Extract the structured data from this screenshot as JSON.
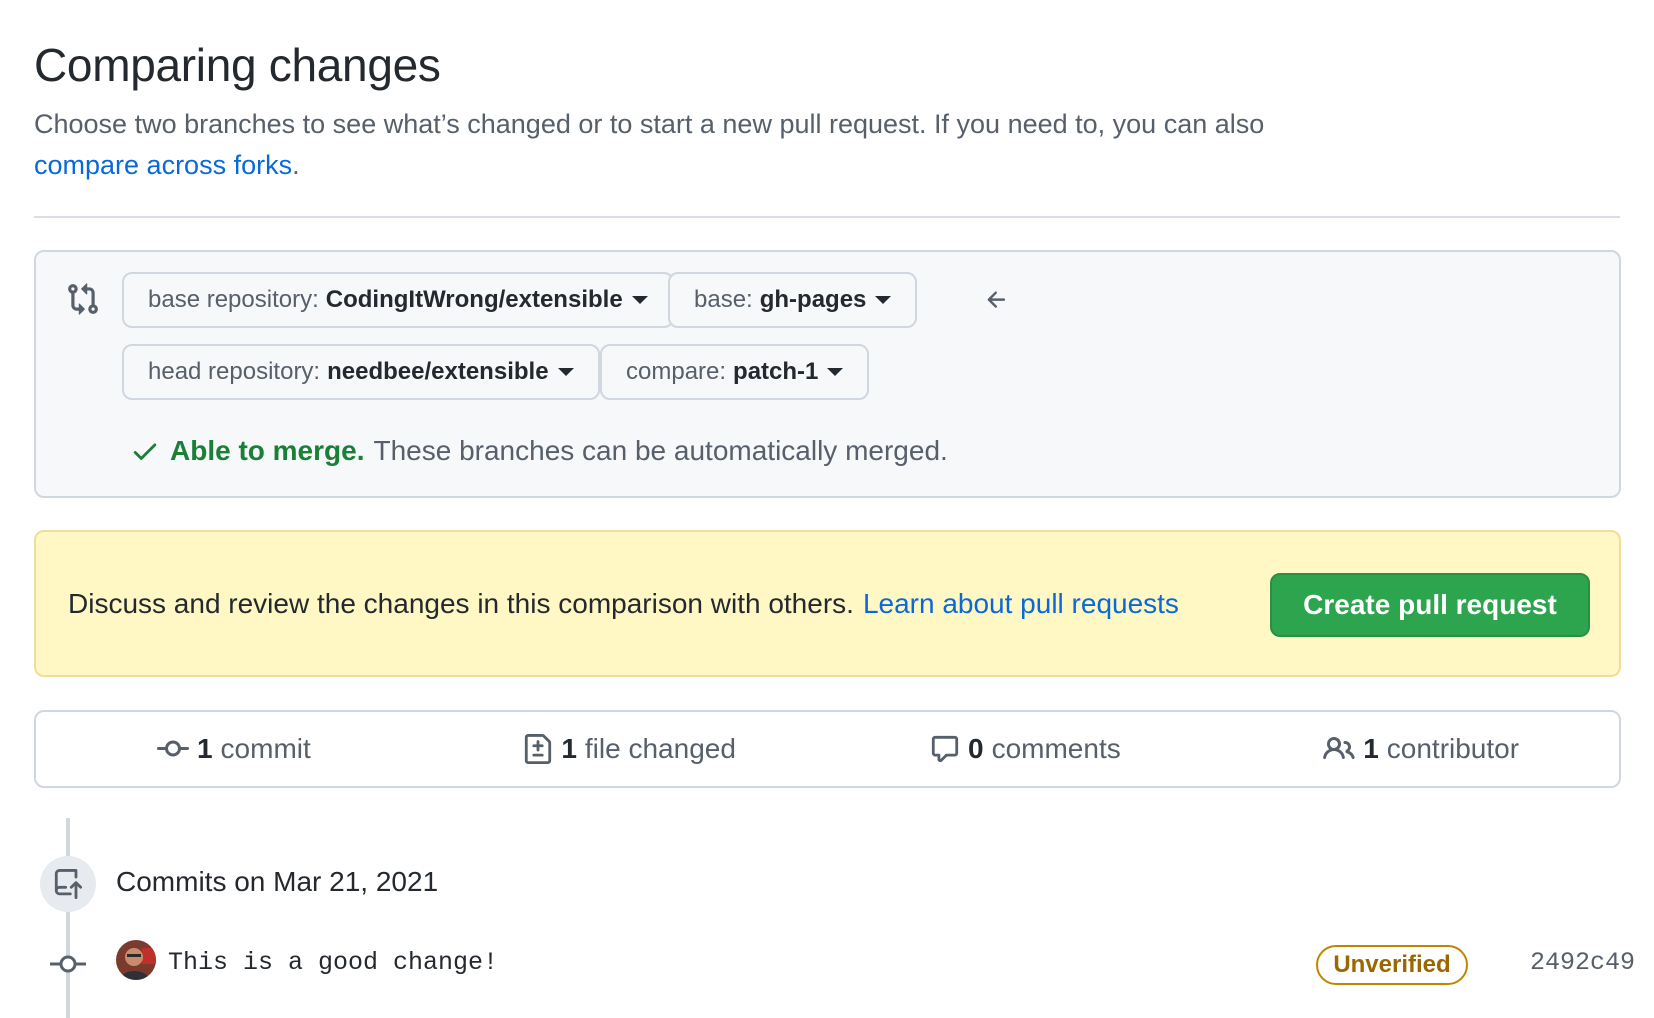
{
  "header": {
    "title": "Comparing changes",
    "description": "Choose two branches to see what’s changed or to start a new pull request. If you need to, you can also",
    "fork_link": "compare across forks",
    "fork_suffix": "."
  },
  "range": {
    "base_repo": {
      "label": "base repository:",
      "value": "CodingItWrong/extensible"
    },
    "base": {
      "label": "base:",
      "value": "gh-pages"
    },
    "head_repo": {
      "label": "head repository:",
      "value": "needbee/extensible"
    },
    "compare": {
      "label": "compare:",
      "value": "patch-1"
    },
    "merge_status": {
      "ok": "Able to merge.",
      "text": "These branches can be automatically merged."
    }
  },
  "flash": {
    "text": "Discuss and review the changes in this comparison with others.",
    "link": "Learn about pull requests",
    "button": "Create pull request"
  },
  "stats": [
    {
      "num": "1",
      "label": "commit",
      "icon": "commit-icon"
    },
    {
      "num": "1",
      "label": "file changed",
      "icon": "file-diff-icon"
    },
    {
      "num": "0",
      "label": "comments",
      "icon": "comment-icon"
    },
    {
      "num": "1",
      "label": "contributor",
      "icon": "people-icon"
    }
  ],
  "timeline": {
    "group_title": "Commits on Mar 21, 2021",
    "commit": {
      "message": "This is a good change!",
      "verification": "Unverified",
      "sha": "2492c49"
    }
  },
  "colors": {
    "link": "#0969da",
    "success": "#1a7f37",
    "button": "#2da44e",
    "flash_bg": "#fff8c5",
    "unverified": "#9a6700"
  }
}
